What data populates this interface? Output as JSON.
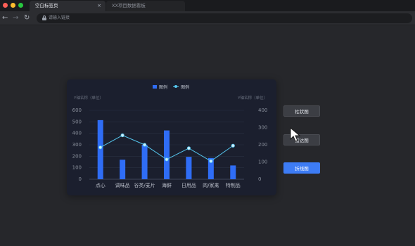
{
  "browser": {
    "active_tab": "空白标签页",
    "inactive_tab": "XX项目数据看板",
    "close_glyph": "×",
    "address_placeholder": "请输入链接",
    "dot_colors": [
      "#ff5f57",
      "#febc2e",
      "#28c840"
    ]
  },
  "chart_data": {
    "type": "bar",
    "categories": [
      "点心",
      "调味品",
      "谷类/麦片",
      "海鲜",
      "日用品",
      "肉/家禽",
      "特制品"
    ],
    "series": [
      {
        "name": "图例",
        "type": "bar",
        "values": [
          515,
          170,
          300,
          425,
          195,
          185,
          120
        ],
        "color": "#2f6df6"
      },
      {
        "name": "图例",
        "type": "line",
        "axis": "right",
        "values": [
          185,
          255,
          200,
          115,
          180,
          105,
          195
        ],
        "color": "#55c6ee"
      }
    ],
    "ylabel": "Y轴名称（单位）",
    "y2label": "Y轴名称（单位）",
    "ylim": [
      0,
      600
    ],
    "y2lim": [
      0,
      400
    ],
    "yticks": [
      "0",
      "100",
      "200",
      "300",
      "400",
      "500",
      "600"
    ],
    "y2ticks": [
      "0",
      "100",
      "200",
      "300",
      "400"
    ],
    "grid": true,
    "legend": "top-center"
  },
  "side_buttons": {
    "bar": "柱状图",
    "radar": "雷达图",
    "line": "折线图"
  }
}
